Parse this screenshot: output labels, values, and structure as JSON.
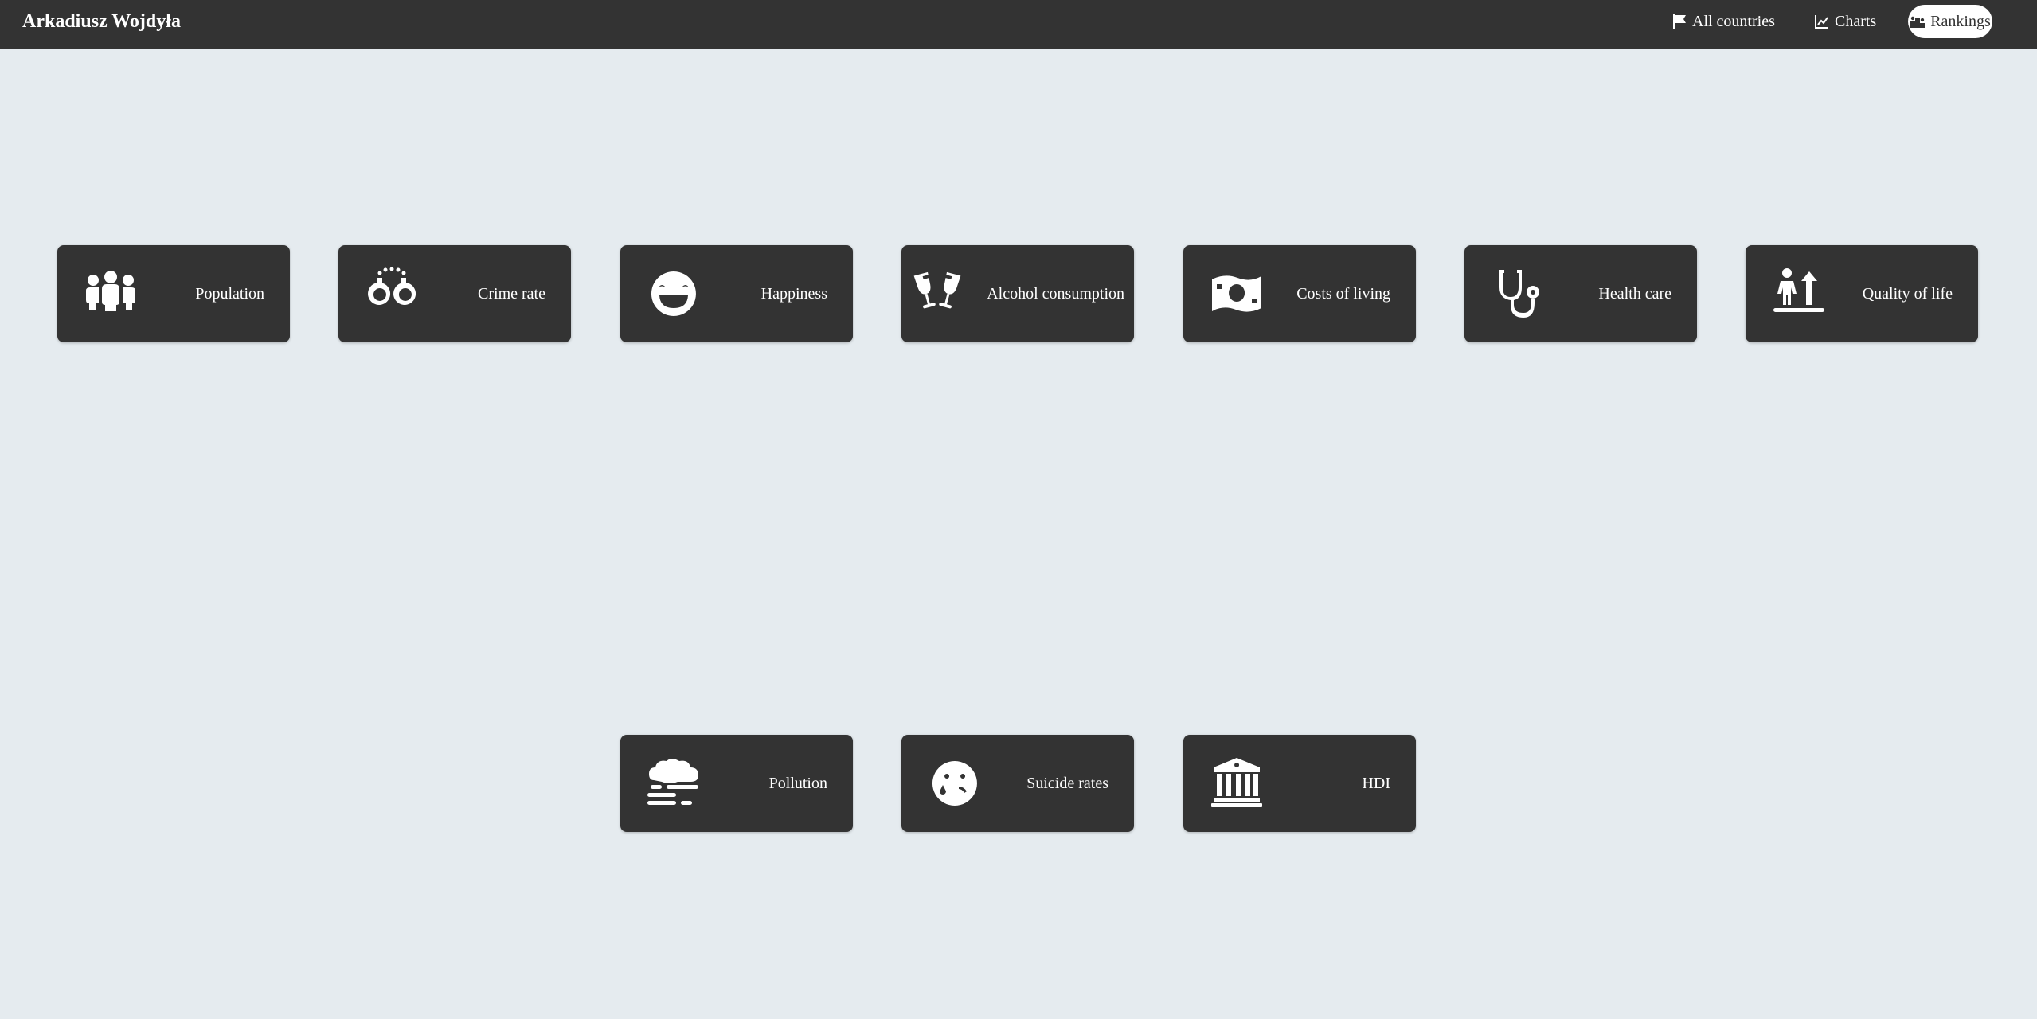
{
  "header": {
    "brand": "Arkadiusz Wojdyła",
    "nav": [
      {
        "label": "All countries",
        "icon": "flag-icon"
      },
      {
        "label": "Charts",
        "icon": "line-chart-icon"
      },
      {
        "label": "Rankings",
        "icon": "ranking-icon",
        "active": true
      }
    ]
  },
  "rankings": [
    {
      "label": "Population",
      "icon": "people-group-icon"
    },
    {
      "label": "Crime rate",
      "icon": "handcuffs-icon"
    },
    {
      "label": "Happiness",
      "icon": "grin-face-icon"
    },
    {
      "label": "Alcohol consumption",
      "icon": "wine-glasses-icon"
    },
    {
      "label": "Costs of living",
      "icon": "money-bill-icon"
    },
    {
      "label": "Health care",
      "icon": "stethoscope-icon"
    },
    {
      "label": "Quality of life",
      "icon": "person-arrow-up-icon"
    },
    {
      "label": "Pollution",
      "icon": "smog-icon"
    },
    {
      "label": "Suicide rates",
      "icon": "sad-tear-icon"
    },
    {
      "label": "HDI",
      "icon": "bank-building-icon"
    }
  ],
  "colors": {
    "background": "#e5ebef",
    "navbar": "#333333",
    "card": "#333333",
    "text": "#ffffff"
  }
}
